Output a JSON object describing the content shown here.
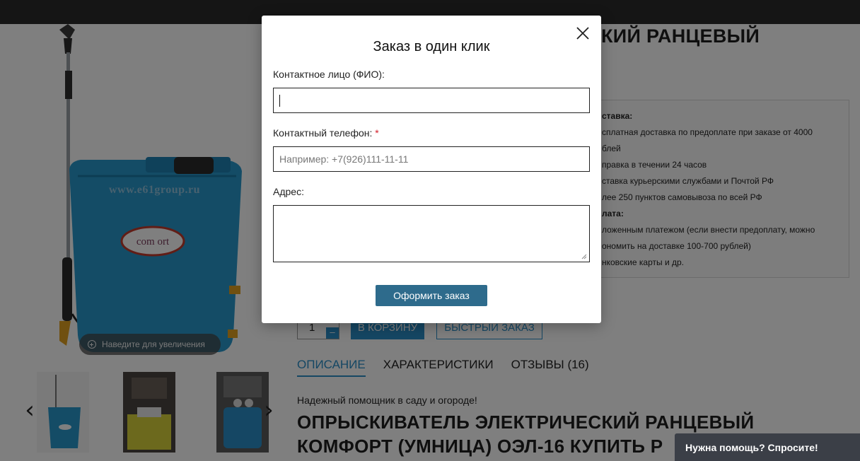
{
  "product": {
    "watermark": "www.e61group.ru",
    "zoom_hint": "Наведите для увеличения",
    "title_visible_fragment": "КИЙ РАНЦЕВЫЙ",
    "info_lines": [
      {
        "text": "ставка:",
        "bold": true
      },
      {
        "text": "сплатная доставка по предоплате при заказе от 4000",
        "bold": false
      },
      {
        "text": "блей",
        "bold": false
      },
      {
        "text": "правка в течении 24 часов",
        "bold": false
      },
      {
        "text": "ставка курьерскими службами и Почтой РФ",
        "bold": false
      },
      {
        "text": "лее 250 пунктов самовывоза по всей РФ",
        "bold": false
      },
      {
        "text": "лата:",
        "bold": true
      },
      {
        "text": "ложенным платежом (если внести предоплату, можно",
        "bold": false
      },
      {
        "text": "ономить на доставке 100-700 рублей)",
        "bold": false
      },
      {
        "text": "нковские карты и др.",
        "bold": false
      }
    ],
    "quantity": "1",
    "minus_label": "–",
    "cart_button": "В КОРЗИНУ",
    "fast_order_button": "БЫСТРЫЙ ЗАКАЗ",
    "tabs": [
      "ОПИСАНИЕ",
      "ХАРАКТЕРИСТИКИ",
      "ОТЗЫВЫ (16)"
    ],
    "tagline": "Надежный помощник в саду и огороде!",
    "heading_line1": "ОПРЫСКИВАТЕЛЬ ЭЛЕКТРИЧЕСКИЙ РАНЦЕВЫЙ",
    "heading_line2": "КОМФОРТ (УМНИЦА) ОЭЛ-16 КУПИТЬ Р",
    "brand_logo": "comfort"
  },
  "modal": {
    "title": "Заказ в один клик",
    "name_label": "Контактное лицо (ФИО):",
    "name_value": "",
    "phone_label": "Контактный телефон:",
    "required_mark": "*",
    "phone_placeholder": "Например: +7(926)111-11-11",
    "address_label": "Адрес:",
    "address_value": "",
    "submit_label": "Оформить заказ"
  },
  "help_button": "Нужна помощь? Спросите!",
  "colors": {
    "accent": "#2a8fc9",
    "submit": "#2e6b8c",
    "topbar": "#2b2b2b",
    "help_bg": "#3b3f47",
    "required": "#d3202b"
  }
}
